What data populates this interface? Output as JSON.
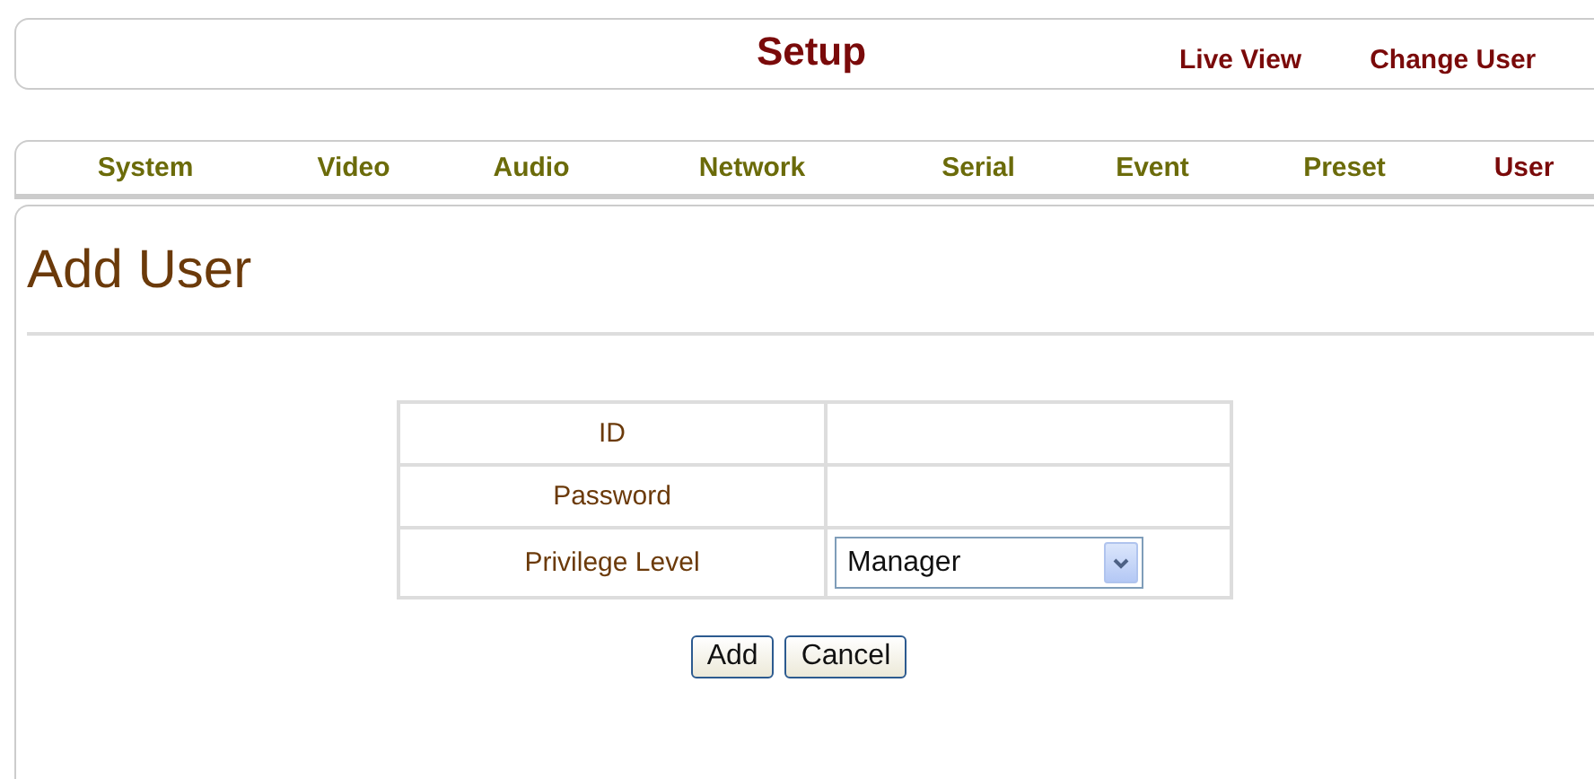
{
  "header": {
    "title": "Setup",
    "links": [
      "Live View",
      "Change User"
    ]
  },
  "tabs": [
    {
      "label": "System",
      "selected": false
    },
    {
      "label": "Video",
      "selected": false
    },
    {
      "label": "Audio",
      "selected": false
    },
    {
      "label": "Network",
      "selected": false
    },
    {
      "label": "Serial",
      "selected": false
    },
    {
      "label": "Event",
      "selected": false
    },
    {
      "label": "Preset",
      "selected": false
    },
    {
      "label": "User",
      "selected": true
    }
  ],
  "page_title": "Add User",
  "form": [
    {
      "label": "ID",
      "kind": "empty"
    },
    {
      "label": "Password",
      "kind": "empty"
    },
    {
      "label": "Privilege Level",
      "kind": "select",
      "value": "Manager"
    }
  ],
  "buttons": [
    "Add",
    "Cancel"
  ]
}
